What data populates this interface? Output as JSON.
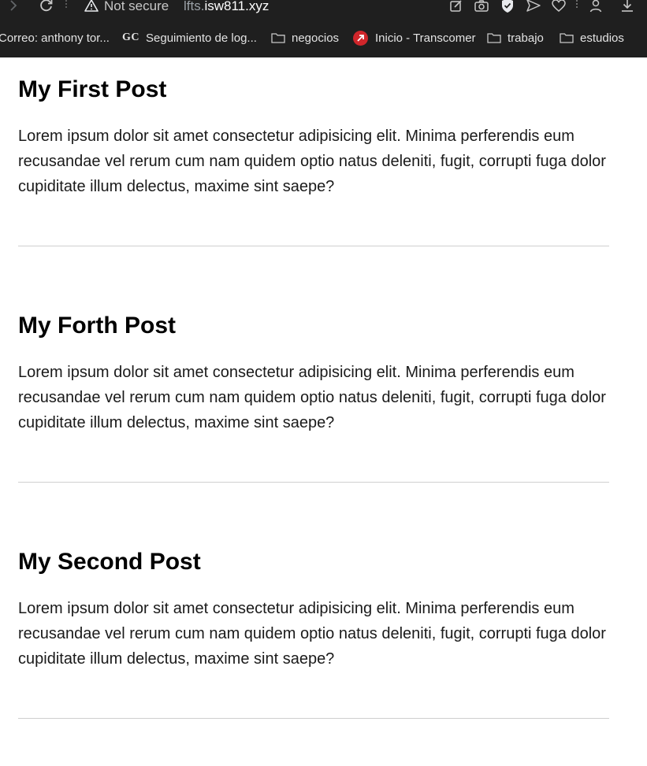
{
  "browser": {
    "security_label": "Not secure",
    "url_prefix": "lfts.",
    "url_host": "isw811.xyz",
    "bookmarks": [
      {
        "label": "Correo: anthony tor...",
        "icon": "none"
      },
      {
        "label": "Seguimiento de log...",
        "icon": "gc-logo"
      },
      {
        "label": "negocios",
        "icon": "folder-icon"
      },
      {
        "label": "Inicio - Transcomer",
        "icon": "transcomer-logo"
      },
      {
        "label": "trabajo",
        "icon": "folder-icon"
      },
      {
        "label": "estudios",
        "icon": "folder-icon"
      }
    ],
    "gc_logo_text": "GC"
  },
  "posts": [
    {
      "title": "My First Post",
      "body": "Lorem ipsum dolor sit amet consectetur adipisicing elit. Minima perferendis eum recusandae vel rerum cum nam quidem optio natus deleniti, fugit, corrupti fuga dolor cupiditate illum delectus, maxime sint saepe?"
    },
    {
      "title": "My Forth Post",
      "body": "Lorem ipsum dolor sit amet consectetur adipisicing elit. Minima perferendis eum recusandae vel rerum cum nam quidem optio natus deleniti, fugit, corrupti fuga dolor cupiditate illum delectus, maxime sint saepe?"
    },
    {
      "title": "My Second Post",
      "body": "Lorem ipsum dolor sit amet consectetur adipisicing elit. Minima perferendis eum recusandae vel rerum cum nam quidem optio natus deleniti, fugit, corrupti fuga dolor cupiditate illum delectus, maxime sint saepe?"
    }
  ],
  "colors": {
    "chrome_bg": "#1f1f1f",
    "transcomer_red": "#d0262b",
    "divider": "#cfcfcf"
  }
}
